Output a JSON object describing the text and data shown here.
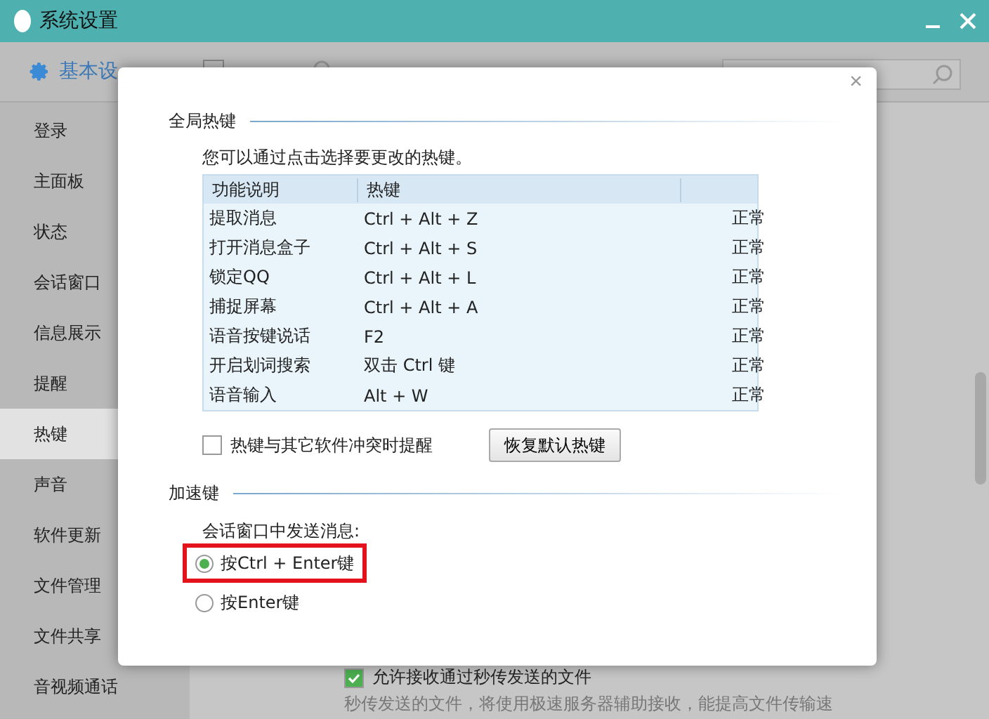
{
  "window": {
    "title": "系统设置"
  },
  "toolbar": {
    "tabs": [
      {
        "label": "基本设",
        "selected": true
      }
    ]
  },
  "sidebar": {
    "items": [
      {
        "label": "登录",
        "selected": false
      },
      {
        "label": "主面板",
        "selected": false
      },
      {
        "label": "状态",
        "selected": false
      },
      {
        "label": "会话窗口",
        "selected": false
      },
      {
        "label": "信息展示",
        "selected": false
      },
      {
        "label": "提醒",
        "selected": false
      },
      {
        "label": "热键",
        "selected": true
      },
      {
        "label": "声音",
        "selected": false
      },
      {
        "label": "软件更新",
        "selected": false
      },
      {
        "label": "文件管理",
        "selected": false
      },
      {
        "label": "文件共享",
        "selected": false
      },
      {
        "label": "音视频通话",
        "selected": false
      }
    ]
  },
  "background_option": {
    "label": "允许接收通过秒传发送的文件",
    "checked": true,
    "note": "秒传发送的文件，将使用极速服务器辅助接收，能提高文件传输速"
  },
  "dialog": {
    "close": "×",
    "global_hotkeys": {
      "title": "全局热键",
      "hint": "您可以通过点击选择要更改的热键。",
      "columns": [
        "功能说明",
        "热键"
      ],
      "rows": [
        {
          "name": "提取消息",
          "keys": "Ctrl + Alt + Z",
          "status": "正常"
        },
        {
          "name": "打开消息盒子",
          "keys": "Ctrl + Alt + S",
          "status": "正常"
        },
        {
          "name": "锁定QQ",
          "keys": "Ctrl + Alt + L",
          "status": "正常"
        },
        {
          "name": "捕捉屏幕",
          "keys": "Ctrl + Alt + A",
          "status": "正常"
        },
        {
          "name": "语音按键说话",
          "keys": "F2",
          "status": "正常"
        },
        {
          "name": "开启划词搜索",
          "keys": "双击 Ctrl 键",
          "status": "正常"
        },
        {
          "name": "语音输入",
          "keys": "Alt + W",
          "status": "正常"
        }
      ],
      "conflict_alert": {
        "label": "热键与其它软件冲突时提醒",
        "checked": false
      },
      "restore_button": "恢复默认热键"
    },
    "shortcut_keys": {
      "title": "加速键",
      "prompt": "会话窗口中发送消息:",
      "options": [
        {
          "label": "按Ctrl + Enter键",
          "selected": true,
          "highlighted": true
        },
        {
          "label": "按Enter键",
          "selected": false,
          "highlighted": false
        }
      ]
    }
  }
}
